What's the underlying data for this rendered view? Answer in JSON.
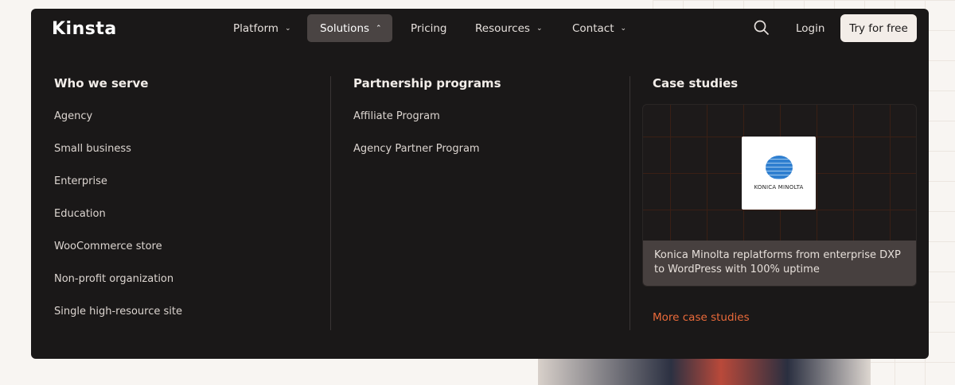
{
  "brand": "Kinsta",
  "nav": {
    "items": [
      {
        "label": "Platform",
        "chevron": "down"
      },
      {
        "label": "Solutions",
        "chevron": "up"
      },
      {
        "label": "Pricing"
      },
      {
        "label": "Resources",
        "chevron": "down"
      },
      {
        "label": "Contact",
        "chevron": "down"
      }
    ],
    "login": "Login",
    "cta": "Try for free"
  },
  "columns": {
    "serve": {
      "title": "Who we serve",
      "items": [
        "Agency",
        "Small business",
        "Enterprise",
        "Education",
        "WooCommerce store",
        "Non-profit organization",
        "Single high-resource site"
      ]
    },
    "partner": {
      "title": "Partnership programs",
      "items": [
        "Affiliate Program",
        "Agency Partner Program"
      ]
    },
    "cases": {
      "title": "Case studies",
      "logo_text": "KONICA MINOLTA",
      "caption": "Konica Minolta replatforms from enterprise DXP to WordPress with 100% uptime",
      "more": "More case studies"
    }
  },
  "colors": {
    "accent": "#ea6a3a",
    "panel": "#1a1818"
  }
}
